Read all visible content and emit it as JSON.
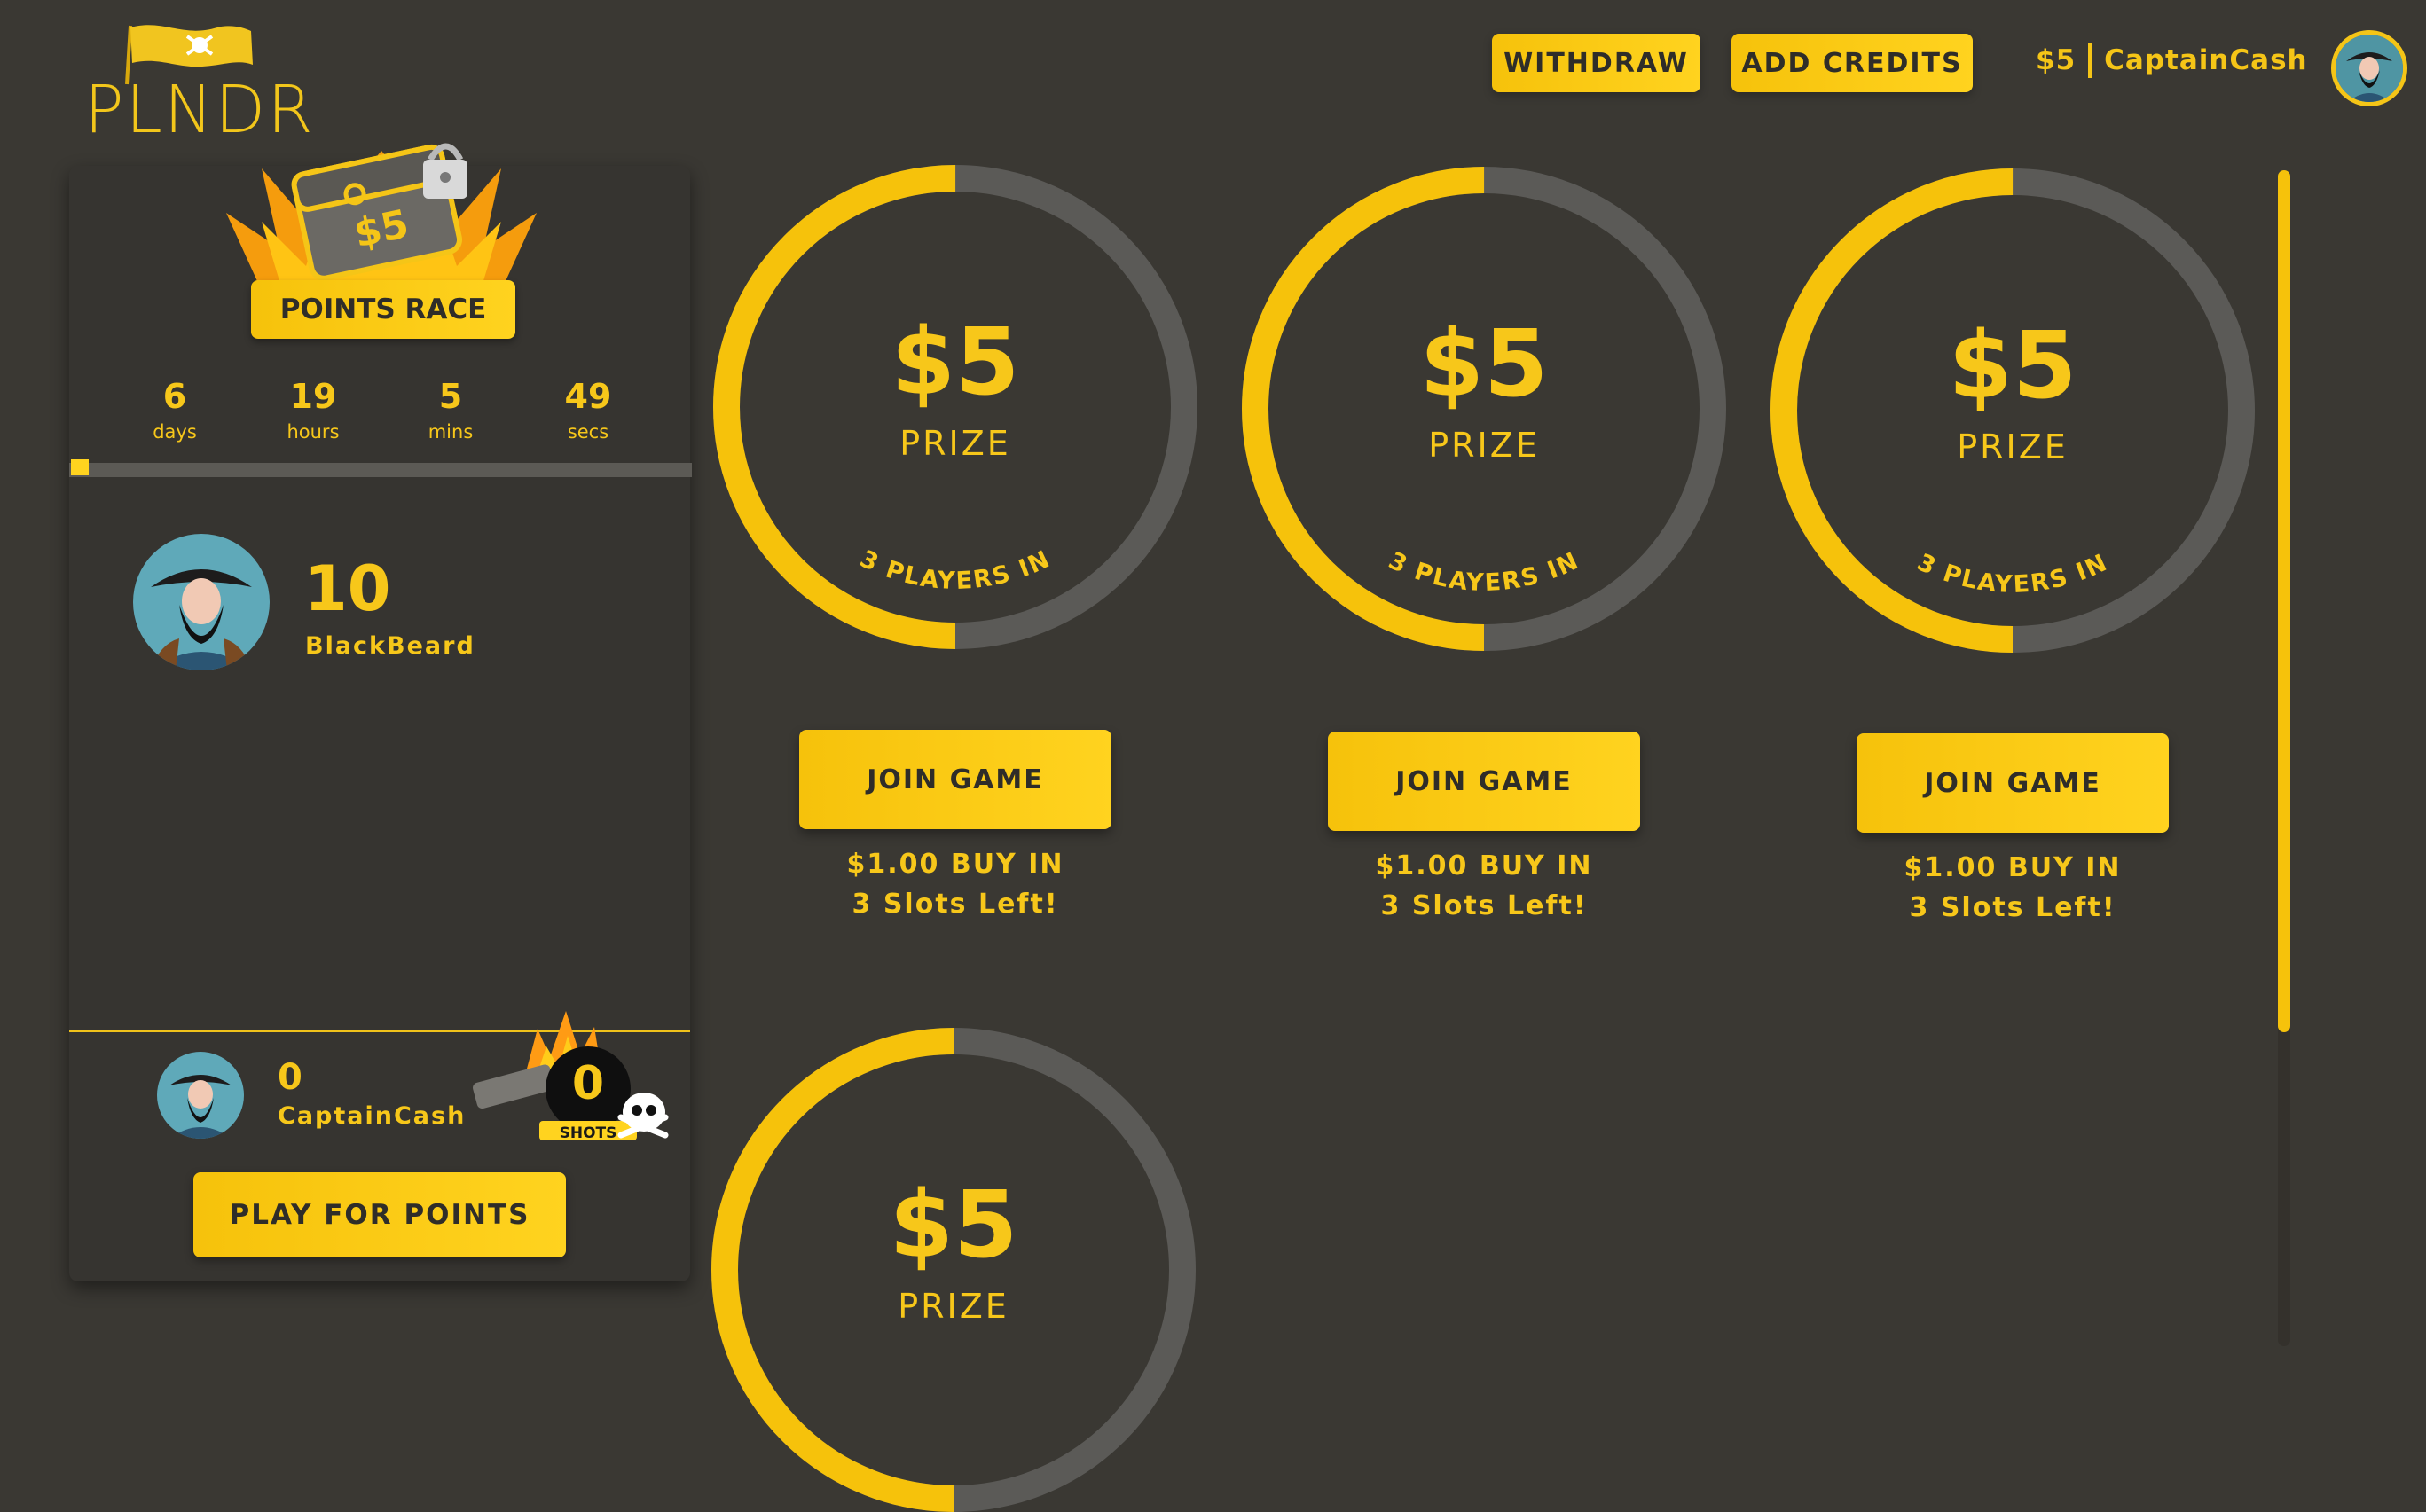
{
  "header": {
    "logo_text": "PLNDR",
    "withdraw_label": "WITHDRAW",
    "add_credits_label": "ADD CREDITS",
    "balance": "$5",
    "username": "CaptainCash"
  },
  "sidebar": {
    "badge_amount": "$5",
    "race_title": "POINTS RACE",
    "countdown": [
      {
        "value": "6",
        "unit": "days"
      },
      {
        "value": "19",
        "unit": "hours"
      },
      {
        "value": "5",
        "unit": "mins"
      },
      {
        "value": "49",
        "unit": "secs"
      }
    ],
    "leader": {
      "score": "10",
      "name": "BlackBeard"
    },
    "me": {
      "score": "0",
      "name": "CaptainCash"
    },
    "shots": {
      "count": "0",
      "label": "SHOTS"
    },
    "play_label": "PLAY FOR POINTS"
  },
  "games": [
    {
      "prize": "$5",
      "prize_label": "PRIZE",
      "players": "3 PLAYERS IN",
      "fill_fraction": 0.5,
      "join_label": "JOIN GAME",
      "buy_in": "$1.00 BUY IN",
      "slots": "3 Slots Left!"
    },
    {
      "prize": "$5",
      "prize_label": "PRIZE",
      "players": "3 PLAYERS IN",
      "fill_fraction": 0.5,
      "join_label": "JOIN GAME",
      "buy_in": "$1.00 BUY IN",
      "slots": "3 Slots Left!"
    },
    {
      "prize": "$5",
      "prize_label": "PRIZE",
      "players": "3 PLAYERS IN",
      "fill_fraction": 0.5,
      "join_label": "JOIN GAME",
      "buy_in": "$1.00 BUY IN",
      "slots": "3 Slots Left!"
    },
    {
      "prize": "$5",
      "prize_label": "PRIZE",
      "players": "",
      "fill_fraction": 0.5,
      "join_label": "",
      "buy_in": "",
      "slots": ""
    }
  ],
  "colors": {
    "accent": "#f6c20b",
    "background": "#3a3833",
    "ring_track": "#5b5a57"
  },
  "icons": [
    "pirate-flag-logo",
    "treasure-chest-icon",
    "lock-icon",
    "cannon-icon",
    "skull-icon",
    "flame-icon"
  ]
}
